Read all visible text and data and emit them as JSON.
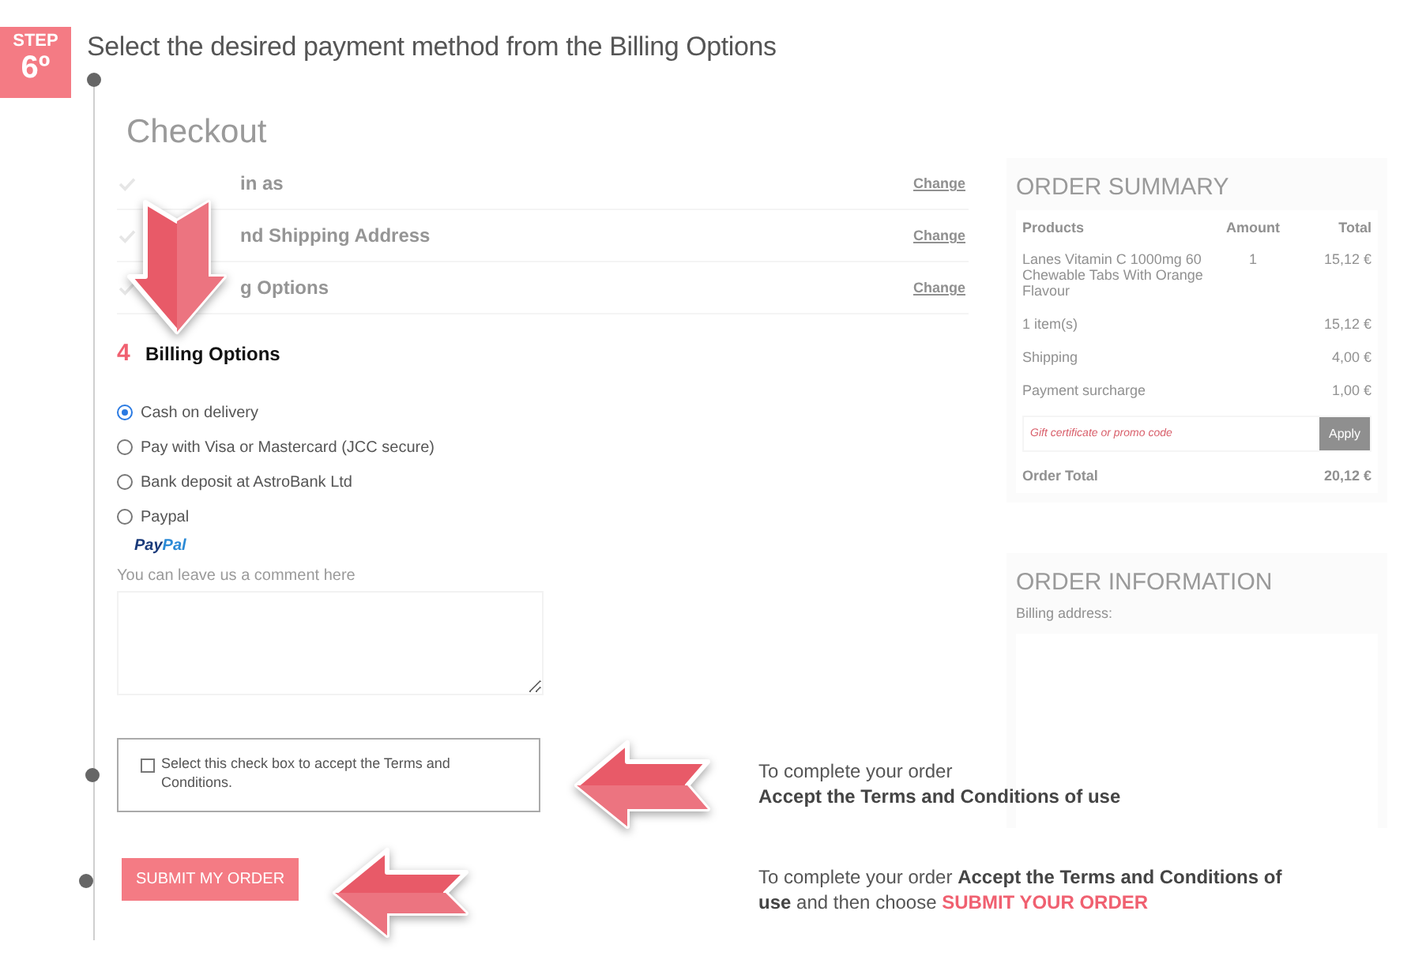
{
  "step": {
    "label": "STEP",
    "number": "6º"
  },
  "instruction": "Select the desired payment method from the Billing Options",
  "checkout": {
    "title": "Checkout",
    "steps": [
      {
        "label": "in as",
        "action": "Change",
        "done": true
      },
      {
        "label": "nd Shipping Address",
        "action": "Change",
        "done": true
      },
      {
        "label": "g Options",
        "action": "Change",
        "done": true
      }
    ],
    "current": {
      "number": "4",
      "label": "Billing Options"
    },
    "payment_options": [
      {
        "label": "Cash on delivery",
        "selected": true
      },
      {
        "label": "Pay with Visa or Mastercard (JCC secure)",
        "selected": false
      },
      {
        "label": "Bank deposit at AstroBank Ltd",
        "selected": false
      },
      {
        "label": "Paypal",
        "selected": false
      }
    ],
    "paypal_logo": {
      "first": "Pay",
      "second": "Pal"
    },
    "comment_label": "You can leave us a comment here",
    "terms": {
      "label": "Select this check box to accept the Terms and Conditions.",
      "checked": false
    },
    "submit": "SUBMIT MY ORDER"
  },
  "order_summary": {
    "title": "ORDER SUMMARY",
    "columns": [
      "Products",
      "Amount",
      "Total"
    ],
    "rows": [
      {
        "product": "Lanes Vitamin C 1000mg 60 Chewable Tabs With Orange Flavour",
        "amount": "1",
        "total": "15,12 €"
      }
    ],
    "totals": [
      {
        "label": "1 item(s)",
        "value": "15,12 €"
      },
      {
        "label": "Shipping",
        "value": "4,00 €"
      },
      {
        "label": "Payment surcharge",
        "value": "1,00 €"
      }
    ],
    "promo": {
      "placeholder": "Gift certificate or promo code",
      "button": "Apply"
    },
    "order_total": {
      "label": "Order Total",
      "value": "20,12 €"
    }
  },
  "order_information": {
    "title": "ORDER INFORMATION",
    "billing_label": "Billing address:"
  },
  "notes": [
    {
      "text": "To complete your order\n**Accept the Terms and Conditions of use**"
    },
    {
      "text": "To complete your order **Accept the Terms and Conditions of use** and then choose",
      "highlight": "SUBMIT YOUR ORDER"
    }
  ]
}
